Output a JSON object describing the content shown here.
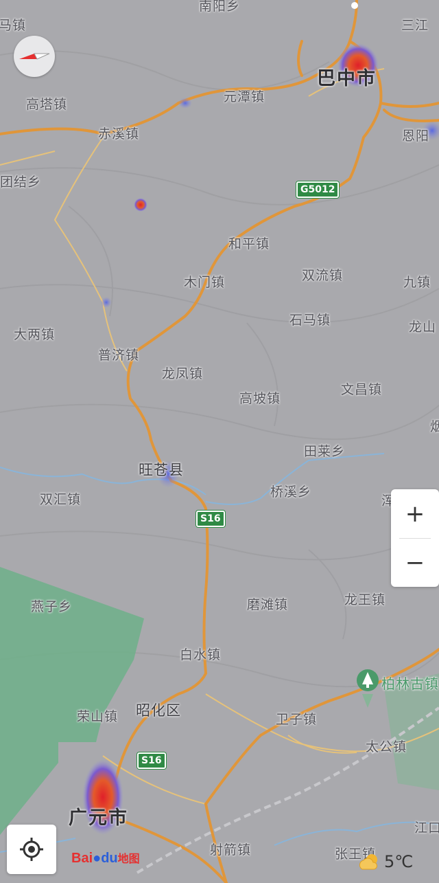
{
  "map": {
    "labels": {
      "top_town_left": "马镇",
      "top_town_mid": "南阳乡",
      "top_town_right": "三江",
      "gaota": "高塔镇",
      "yuantan": "元潭镇",
      "bazhong": "巴中市",
      "enyang": "恩阳",
      "chixi": "赤溪镇",
      "tuanjie": "团结乡",
      "heping": "和平镇",
      "mumen": "木门镇",
      "shuangliu": "双流镇",
      "jiuzhen": "九镇",
      "shima": "石马镇",
      "longshan": "龙山",
      "daliang": "大两镇",
      "puji": "普济镇",
      "longfeng": "龙凤镇",
      "gaopo": "高坡镇",
      "wenchang": "文昌镇",
      "yan_edge": "烟",
      "tianlai": "田莱乡",
      "wangcang": "旺苍县",
      "qiaoxi": "桥溪乡",
      "shuanghui": "双汇镇",
      "yanzi": "燕子乡",
      "motan": "磨滩镇",
      "longwang": "龙王镇",
      "baishui": "白水镇",
      "bailin": "柏林古镇",
      "rongshan": "荣山镇",
      "zhaohua": "昭化区",
      "weizi": "卫子镇",
      "taigong": "太公镇",
      "guangyuan": "广元市",
      "shejian": "射箭镇",
      "zhangwang": "张王镇",
      "jiangkou": "江口",
      "hun_edge": "浑"
    },
    "shields": {
      "g5012": "G5012",
      "s16_a": "S16",
      "s16_b": "S16"
    }
  },
  "controls": {
    "zoom_in": "+",
    "zoom_out": "−",
    "locate_icon": "locate-icon",
    "compass_icon": "compass-icon"
  },
  "logo": {
    "bai": "Bai",
    "du": "du",
    "ditu": "地图"
  },
  "weather": {
    "icon": "partly-cloudy-icon",
    "temperature": "5℃"
  },
  "colors": {
    "road": "#e0963a",
    "forest": "#6fb08a",
    "land": "#a9a9ad",
    "shield": "#2f8a45"
  }
}
